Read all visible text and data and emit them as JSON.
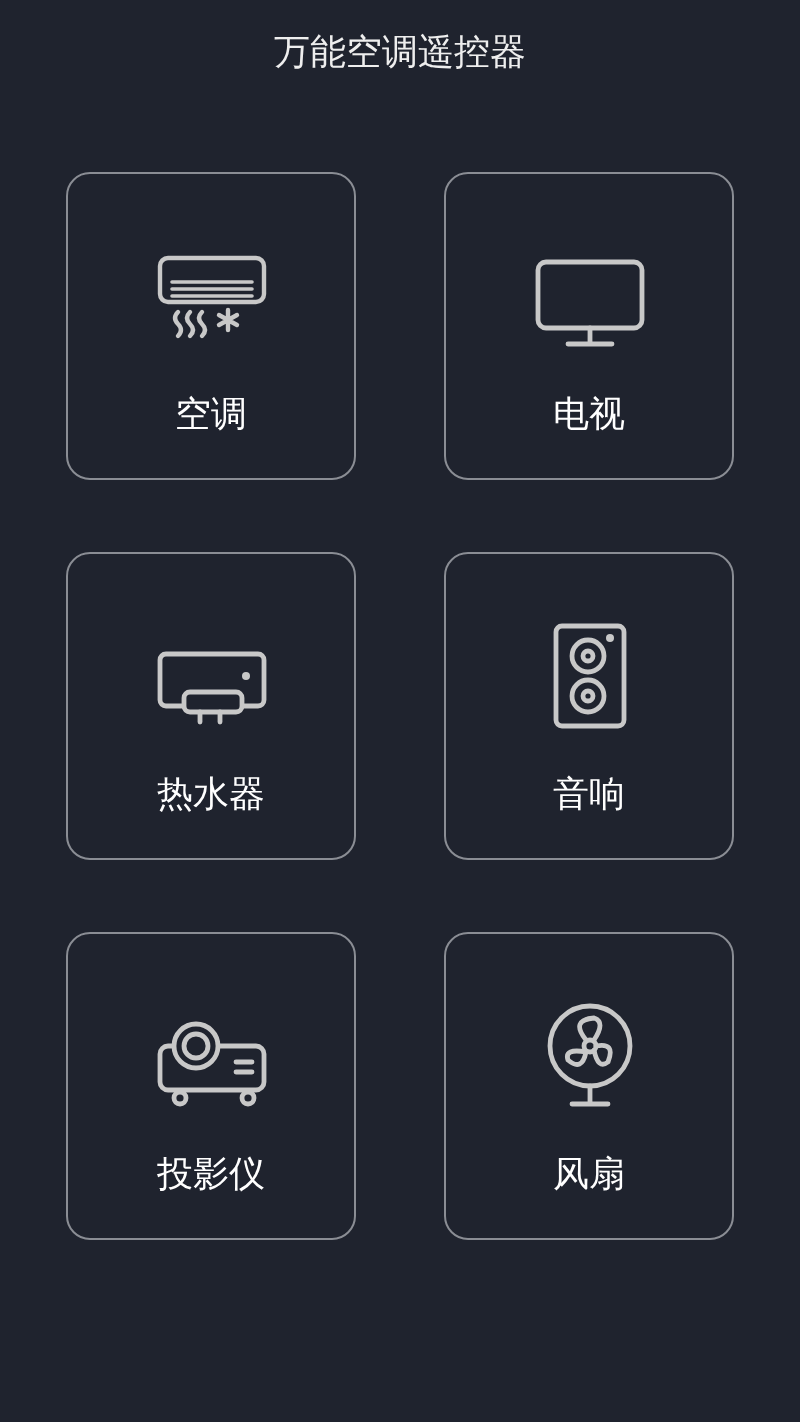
{
  "title": "万能空调遥控器",
  "devices": [
    {
      "kind": "aircon",
      "label": "空调"
    },
    {
      "kind": "tv",
      "label": "电视"
    },
    {
      "kind": "heater",
      "label": "热水器"
    },
    {
      "kind": "speaker",
      "label": "音响"
    },
    {
      "kind": "projector",
      "label": "投影仪"
    },
    {
      "kind": "fan",
      "label": "风扇"
    }
  ]
}
